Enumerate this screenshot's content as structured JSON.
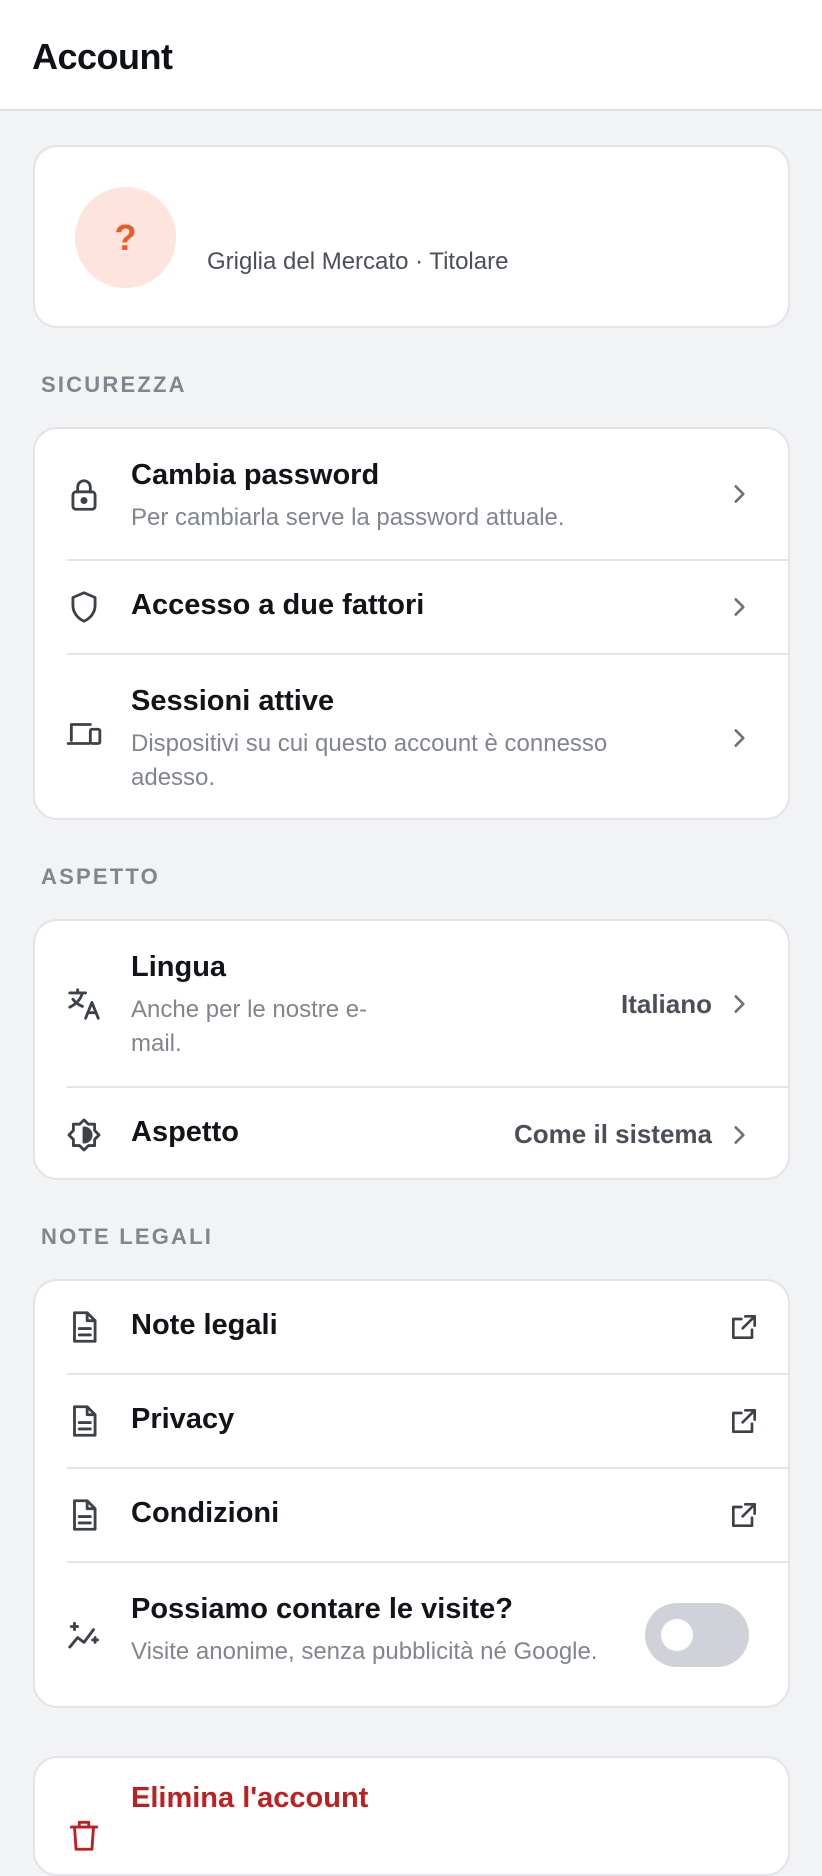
{
  "header": {
    "title": "Account"
  },
  "profile": {
    "avatar_glyph": "?",
    "subtitle": "Griglia del Mercato · Titolare"
  },
  "sections": {
    "security": {
      "label": "SICUREZZA",
      "change_password": {
        "title": "Cambia password",
        "subtitle": "Per cambiarla serve la password attuale."
      },
      "two_factor": {
        "title": "Accesso a due fattori"
      },
      "sessions": {
        "title": "Sessioni attive",
        "subtitle_line1": "Dispositivi su cui questo account è connesso",
        "subtitle_line2": "adesso."
      }
    },
    "appearance": {
      "label": "ASPETTO",
      "language": {
        "title": "Lingua",
        "subtitle_line1": "Anche per le nostre e-",
        "subtitle_line2": "mail.",
        "value": "Italiano"
      },
      "theme": {
        "title": "Aspetto",
        "value": "Come il sistema"
      }
    },
    "legal": {
      "label": "NOTE LEGALI",
      "legal_notes": {
        "title": "Note legali"
      },
      "privacy": {
        "title": "Privacy"
      },
      "terms": {
        "title": "Condizioni"
      },
      "analytics": {
        "title": "Possiamo contare le visite?",
        "subtitle": "Visite anonime, senza pubblicità né Google.",
        "enabled": false
      }
    },
    "danger": {
      "delete_account": {
        "title": "Elimina l'account"
      }
    }
  },
  "colors": {
    "accent_orange": "#ee5a24",
    "avatar_bg": "#fde4dc",
    "danger_red": "#c01f1f",
    "toggle_off": "#cfd2d8"
  },
  "icons": {
    "change_password": "lock-icon",
    "two_factor": "shield-icon",
    "sessions": "devices-icon",
    "language": "translate-icon",
    "theme": "brightness-icon",
    "legal_notes": "document-icon",
    "privacy": "document-icon",
    "terms": "document-icon",
    "analytics": "sparkle-chart-icon",
    "external": "external-link-icon",
    "chevron": "chevron-right-icon"
  }
}
